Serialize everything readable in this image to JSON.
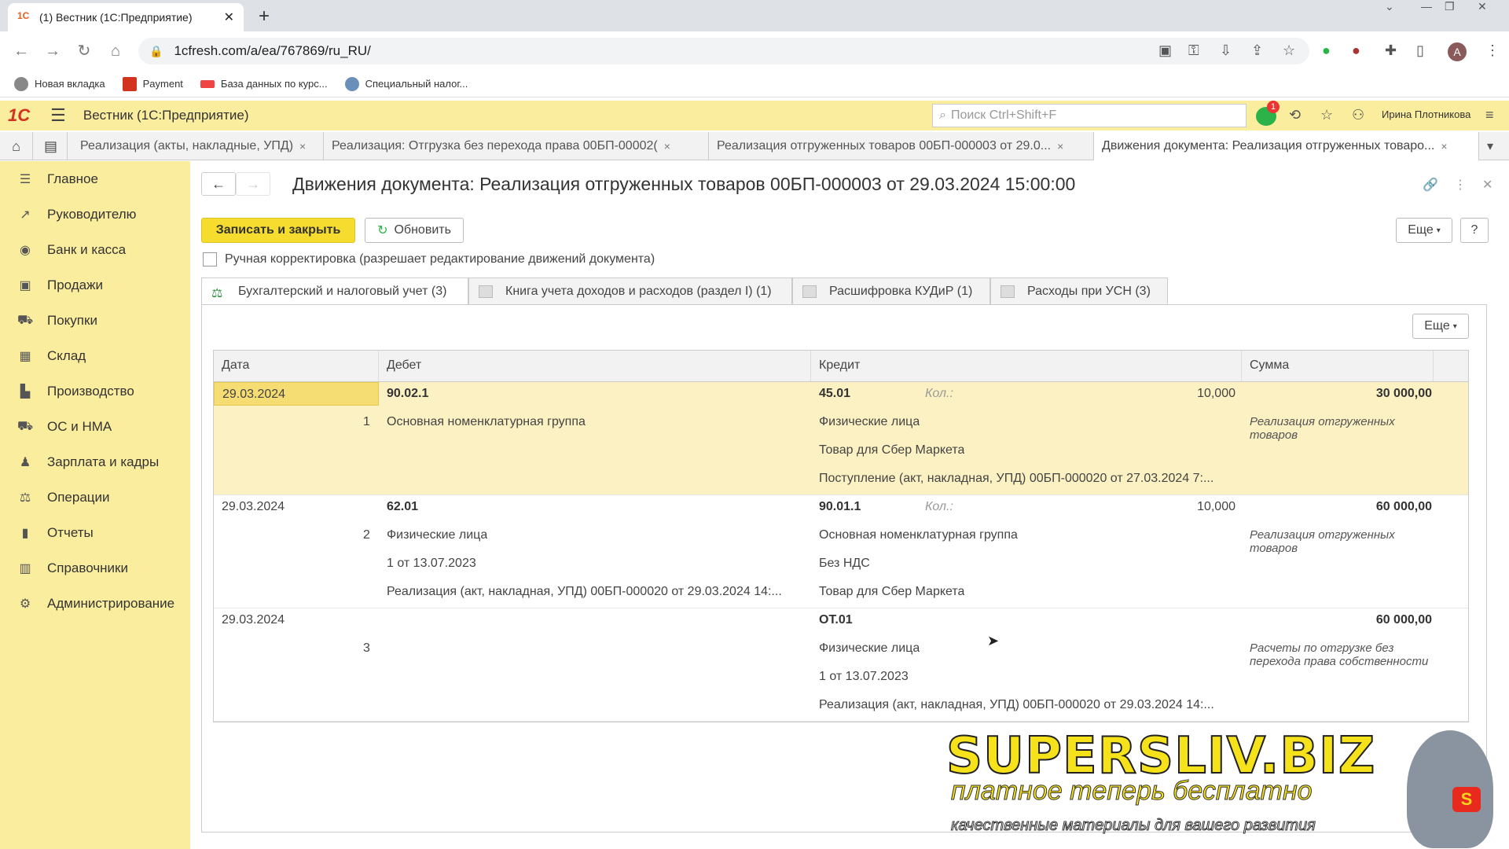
{
  "browser": {
    "tab_title": "(1) Вестник (1С:Предприятие)",
    "url": "1cfresh.com/a/ea/767869/ru_RU/",
    "bookmarks": [
      "Новая вкладка",
      "Payment",
      "База данных по курс...",
      "Специальный налог..."
    ]
  },
  "app": {
    "logo": "1С",
    "title": "Вестник  (1С:Предприятие)",
    "search_placeholder": "Поиск Ctrl+Shift+F",
    "notification_count": "1",
    "user": "Ирина Плотникова"
  },
  "open_tabs": [
    {
      "label": "Реализация (акты, накладные, УПД)"
    },
    {
      "label": "Реализация: Отгрузка без перехода права     00БП-00002("
    },
    {
      "label": "Реализация отгруженных товаров 00БП-000003 от 29.0..."
    },
    {
      "label": "Движения документа: Реализация отгруженных товаро..."
    }
  ],
  "sidebar": {
    "items": [
      {
        "label": "Главное",
        "icon": "menu-icon"
      },
      {
        "label": "Руководителю",
        "icon": "chart-line-icon"
      },
      {
        "label": "Банк и касса",
        "icon": "bank-icon"
      },
      {
        "label": "Продажи",
        "icon": "bag-icon"
      },
      {
        "label": "Покупки",
        "icon": "cart-icon"
      },
      {
        "label": "Склад",
        "icon": "warehouse-icon"
      },
      {
        "label": "Производство",
        "icon": "factory-icon"
      },
      {
        "label": "ОС и НМА",
        "icon": "truck-icon"
      },
      {
        "label": "Зарплата и кадры",
        "icon": "person-icon"
      },
      {
        "label": "Операции",
        "icon": "operations-icon"
      },
      {
        "label": "Отчеты",
        "icon": "bar-chart-icon"
      },
      {
        "label": "Справочники",
        "icon": "book-icon"
      },
      {
        "label": "Администрирование",
        "icon": "gear-icon"
      }
    ]
  },
  "doc": {
    "title": "Движения документа: Реализация отгруженных товаров 00БП-000003 от 29.03.2024 15:00:00",
    "save_close": "Записать и закрыть",
    "refresh": "Обновить",
    "more": "Еще",
    "help": "?",
    "manual_edit": "Ручная корректировка (разрешает редактирование движений документа)",
    "tabs": [
      "Бухгалтерский и налоговый учет (3)",
      "Книга учета доходов и расходов (раздел I) (1)",
      "Расшифровка КУДиР (1)",
      "Расходы при УСН (3)"
    ]
  },
  "grid": {
    "columns": [
      "Дата",
      "Дебет",
      "Кредит",
      "Сумма"
    ],
    "rows": [
      {
        "date": "29.03.2024",
        "num": "1",
        "debit": "90.02.1",
        "debit_sub": [
          "Основная номенклатурная группа"
        ],
        "credit": "45.01",
        "qty_label": "Кол.:",
        "qty": "10,000",
        "credit_sub": [
          "Физические лица",
          "Товар для Сбер Маркета",
          "Поступление (акт, накладная, УПД) 00БП-000020 от 27.03.2024 7:..."
        ],
        "amount": "30 000,00",
        "amount_note": "Реализация отгруженных товаров"
      },
      {
        "date": "29.03.2024",
        "num": "2",
        "debit": "62.01",
        "debit_sub": [
          "Физические лица",
          "1 от 13.07.2023",
          "Реализация (акт, накладная, УПД) 00БП-000020 от 29.03.2024 14:..."
        ],
        "credit": "90.01.1",
        "qty_label": "Кол.:",
        "qty": "10,000",
        "credit_sub": [
          "Основная номенклатурная группа",
          "Без НДС",
          "Товар для Сбер Маркета"
        ],
        "amount": "60 000,00",
        "amount_note": "Реализация отгруженных товаров"
      },
      {
        "date": "29.03.2024",
        "num": "3",
        "debit": "",
        "debit_sub": [],
        "credit": "ОТ.01",
        "credit_sub": [
          "Физические лица",
          "1 от 13.07.2023",
          "Реализация (акт, накладная, УПД) 00БП-000020 от 29.03.2024 14:..."
        ],
        "amount": "60 000,00",
        "amount_note": "Расчеты по отгрузке без перехода права собственности"
      }
    ]
  },
  "watermark": {
    "big": "SUPERSLIV.BIZ",
    "mid": "платное теперь бесплатно",
    "small": "качественные материалы для вашего развития"
  }
}
